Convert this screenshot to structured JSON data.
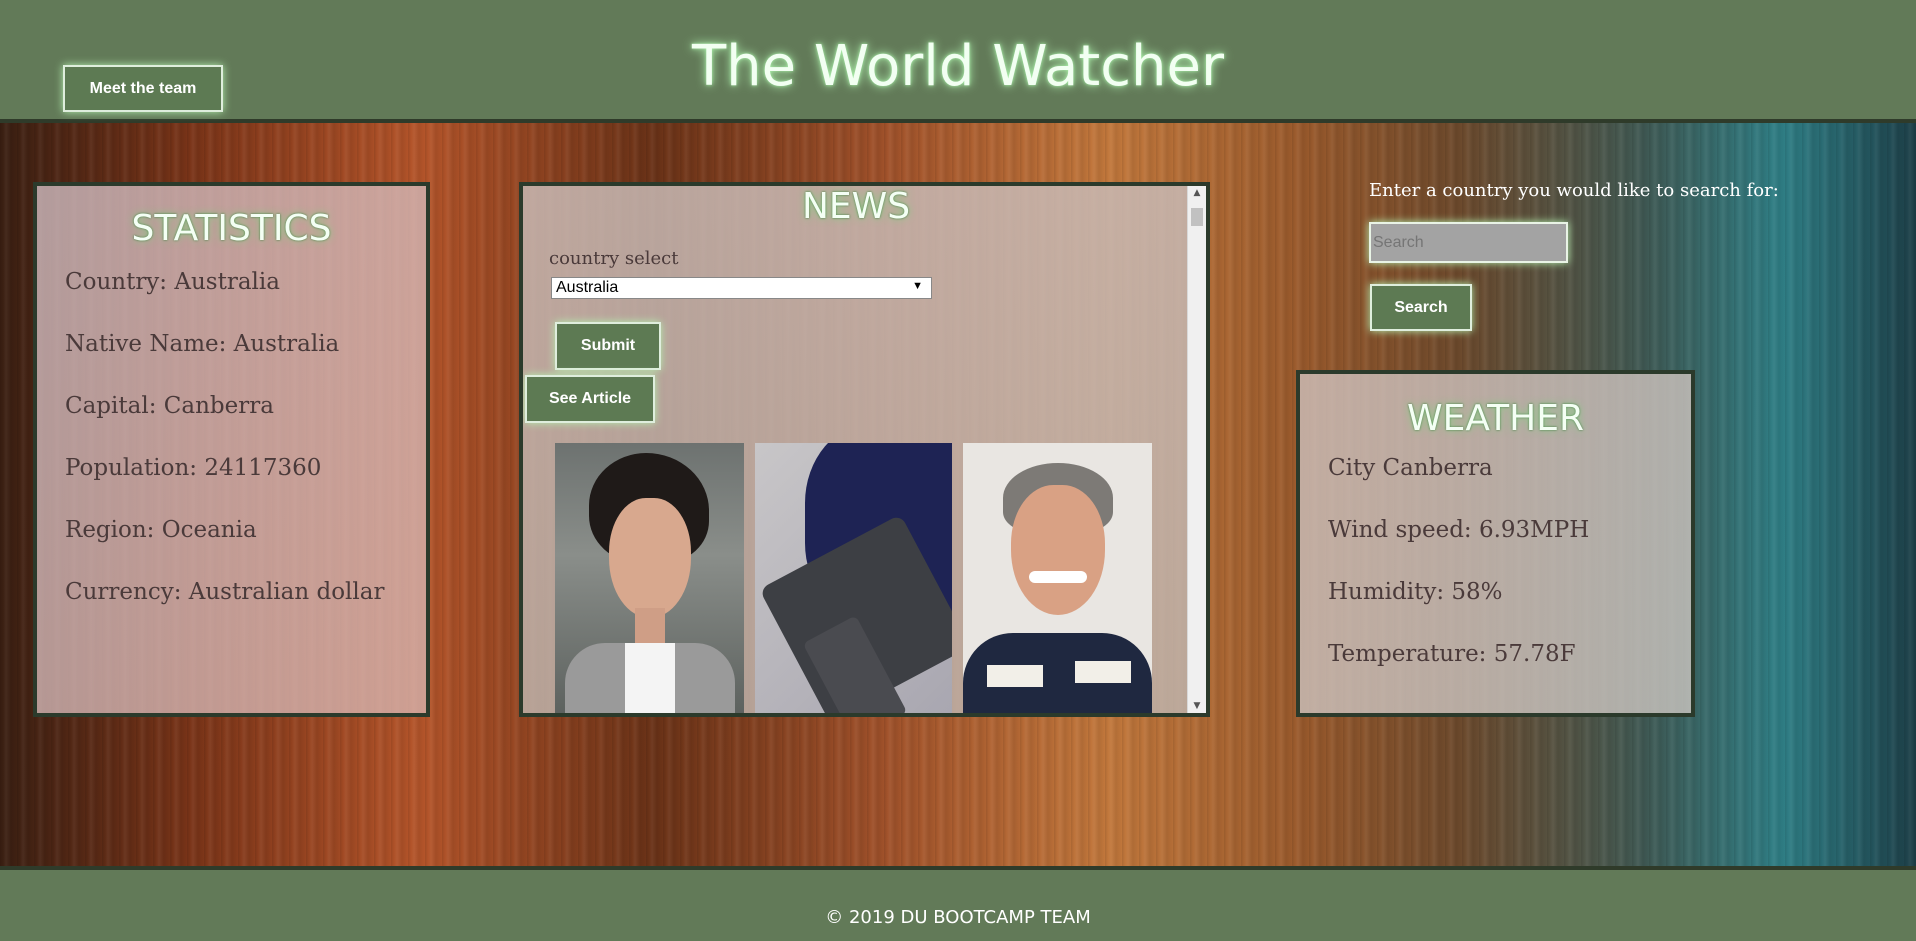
{
  "header": {
    "title": "The World Watcher",
    "team_button": "Meet the team"
  },
  "statistics": {
    "title": "STATISTICS",
    "country": "Country: Australia",
    "native_name": "Native Name: Australia",
    "capital": "Capital: Canberra",
    "population": "Population: 24117360",
    "region": "Region: Oceania",
    "currency": "Currency: Australian dollar"
  },
  "news": {
    "title": "NEWS",
    "select_label": "country select",
    "selected_country": "Australia",
    "submit_label": "Submit",
    "see_article_label": "See Article"
  },
  "search": {
    "prompt": "Enter a country you would like to search for:",
    "placeholder": "Search",
    "button_label": "Search"
  },
  "weather": {
    "title": "WEATHER",
    "city": "City Canberra",
    "wind": "Wind speed: 6.93MPH",
    "humidity": "Humidity: 58%",
    "temperature": "Temperature: 57.78F"
  },
  "footer": {
    "text": "© 2019 DU BOOTCAMP TEAM"
  }
}
